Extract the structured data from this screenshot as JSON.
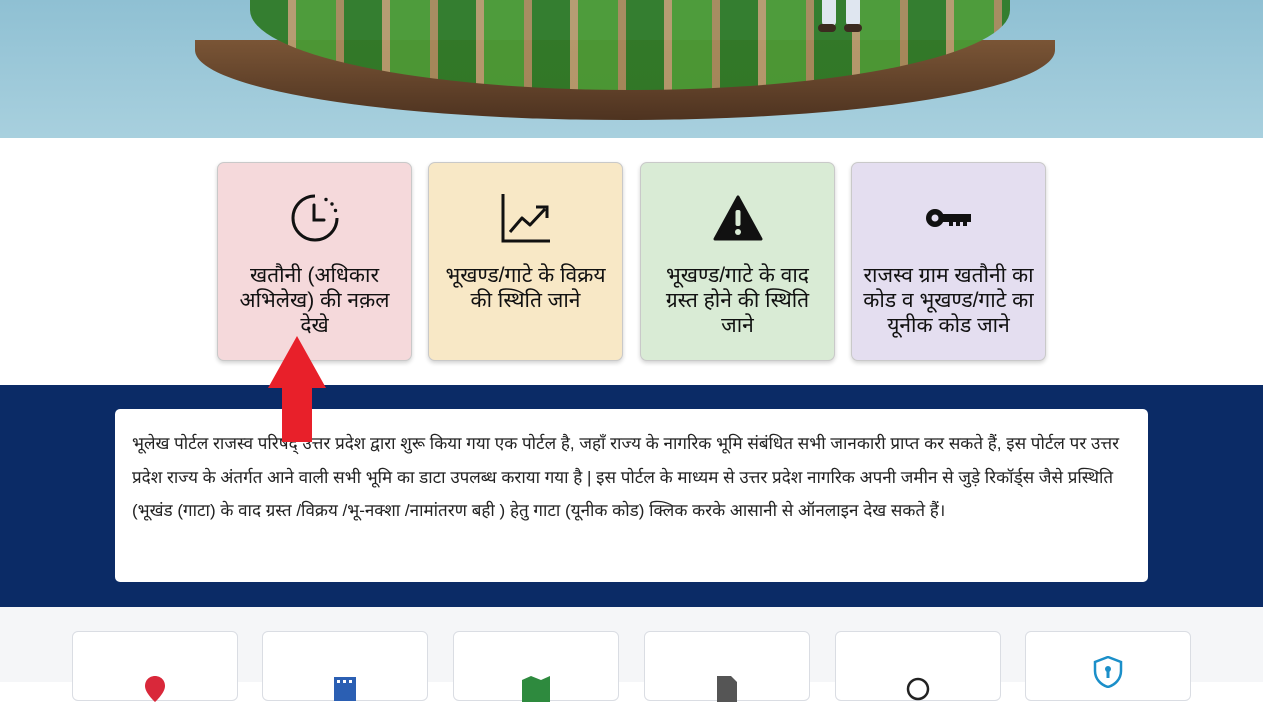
{
  "hero": {
    "alt": "farmland-banner"
  },
  "cards": [
    {
      "label": "खतौनी (अधिकार अभिलेख) की नक़ल देखे",
      "icon": "clock-history-icon",
      "bg": "#f5d9db"
    },
    {
      "label": "भूखण्ड/गाटे के विक्रय की स्थिति जाने",
      "icon": "graph-up-icon",
      "bg": "#f8e8c6"
    },
    {
      "label": "भूखण्ड/गाटे के वाद ग्रस्त होने की स्थिति जाने",
      "icon": "warning-icon",
      "bg": "#d9ebd5"
    },
    {
      "label": "राजस्व ग्राम खतौनी का कोड व भूखण्ड/गाटे का यूनीक कोड जाने",
      "icon": "key-icon",
      "bg": "#e4def0"
    }
  ],
  "info": {
    "text": "भूलेख पोर्टल राजस्व परिषद् उत्तर प्रदेश द्वारा शुरू किया गया एक पोर्टल है, जहाँ राज्य के नागरिक भूमि संबंधित सभी जानकारी प्राप्त कर सकते हैं, इस पोर्टल पर उत्तर प्रदेश राज्य के अंतर्गत आने वाली सभी भूमि का डाटा उपलब्ध कराया गया है | इस पोर्टल के माध्यम से उत्तर प्रदेश नागरिक अपनी जमीन से जुड़े रिकॉर्ड्स जैसे प्रस्थिति (भूखंड (गाटा) के वाद ग्रस्त /विक्रय /भू-नक्शा /नामांतरण बही ) हेतु गाटा (यूनीक कोड) क्लिक करके आसानी से ऑनलाइन देख सकते हैं।"
  },
  "bottom_tiles": [
    {
      "icon": "location-pin-icon",
      "color": "#d9283a"
    },
    {
      "icon": "calendar-grid-icon",
      "color": "#2b5fb3"
    },
    {
      "icon": "map-icon",
      "color": "#2e8a3e"
    },
    {
      "icon": "document-icon",
      "color": "#555555"
    },
    {
      "icon": "circle-icon",
      "color": "#222222"
    },
    {
      "icon": "shield-lock-icon",
      "color": "#1b8fc9"
    }
  ],
  "colors": {
    "navy": "#0b2b66",
    "arrow": "#e8202a"
  }
}
